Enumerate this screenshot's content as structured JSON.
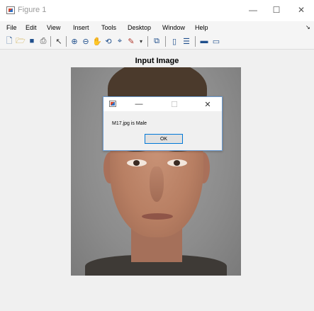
{
  "window": {
    "title": "Figure 1",
    "minimize_glyph": "—",
    "maximize_glyph": "☐",
    "close_glyph": "✕"
  },
  "menu": [
    "File",
    "Edit",
    "View",
    "Insert",
    "Tools",
    "Desktop",
    "Window",
    "Help"
  ],
  "toolbar": {
    "icons": [
      "new-figure-icon",
      "open-file-icon",
      "save-icon",
      "print-icon",
      "edit-plot-icon",
      "zoom-in-icon",
      "zoom-out-icon",
      "pan-icon",
      "rotate-3d-icon",
      "data-cursor-icon",
      "brush-icon",
      "link-plot-icon",
      "insert-colorbar-icon",
      "insert-legend-icon",
      "hide-plot-tools-icon",
      "show-plot-tools-icon"
    ]
  },
  "axes": {
    "title": "Input Image"
  },
  "dialog": {
    "message": "M17.jpg is Male",
    "ok_label": "OK"
  },
  "colors": {
    "dialog_border": "#6b9bd1",
    "ok_border": "#0078d7"
  }
}
